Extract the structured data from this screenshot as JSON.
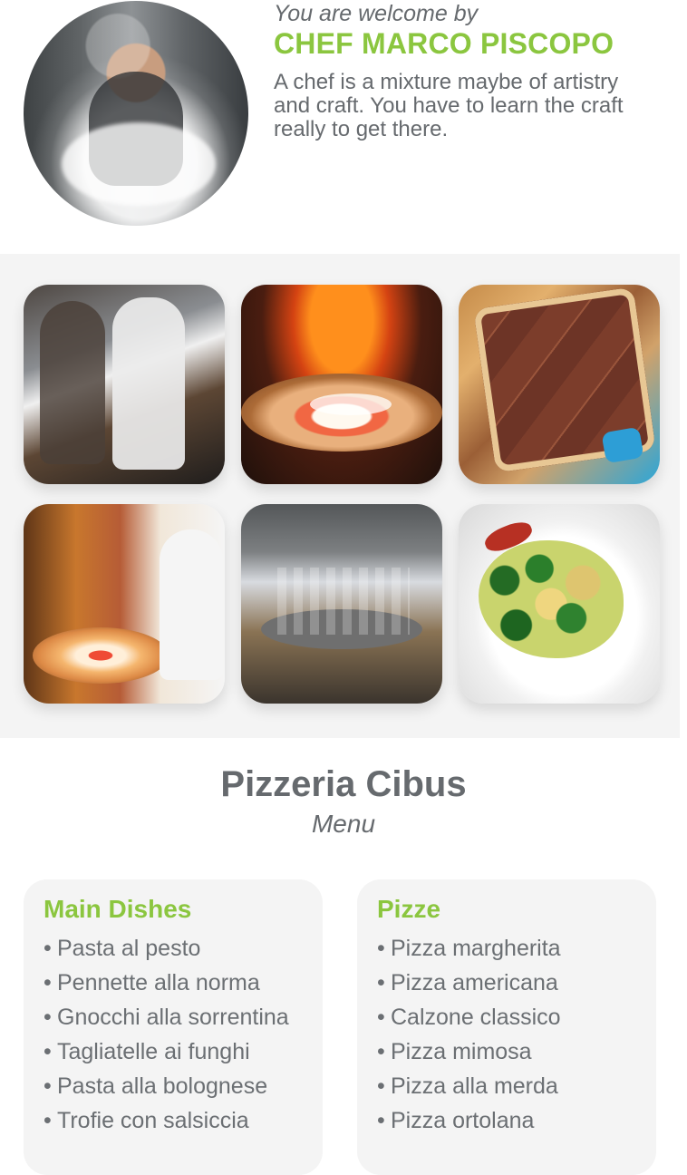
{
  "header": {
    "welcome": "You are welcome by",
    "chef_name": "CHEF MARCO PISCOPO",
    "quote": "A chef is a mixture maybe of artistry and craft. You have to learn the craft really to get there."
  },
  "gallery": {
    "photos": [
      {
        "name": "chef-group-photo"
      },
      {
        "name": "wood-fired-pizza-photo"
      },
      {
        "name": "baked-flatbread-photo"
      },
      {
        "name": "pizza-oven-kitchen-photo"
      },
      {
        "name": "restaurant-dining-room-photo"
      },
      {
        "name": "broccoli-penne-photo"
      }
    ]
  },
  "menu": {
    "restaurant_name": "Pizzeria Cibus",
    "subtitle": "Menu",
    "bullet": "•",
    "main_dishes": {
      "heading": "Main Dishes",
      "items": [
        "Pasta al pesto",
        "Pennette alla norma",
        "Gnocchi alla sorrentina",
        "Tagliatelle ai funghi",
        "Pasta alla bolognese",
        "Trofie con salsiccia"
      ]
    },
    "pizze": {
      "heading": "Pizze",
      "items": [
        "Pizza margherita",
        "Pizza americana",
        "Calzone classico",
        "Pizza mimosa",
        "Pizza alla merda",
        "Pizza ortolana"
      ]
    }
  },
  "colors": {
    "accent_green": "#8bc63f",
    "text_gray": "#666a6e",
    "panel_gray": "#f4f4f4"
  }
}
